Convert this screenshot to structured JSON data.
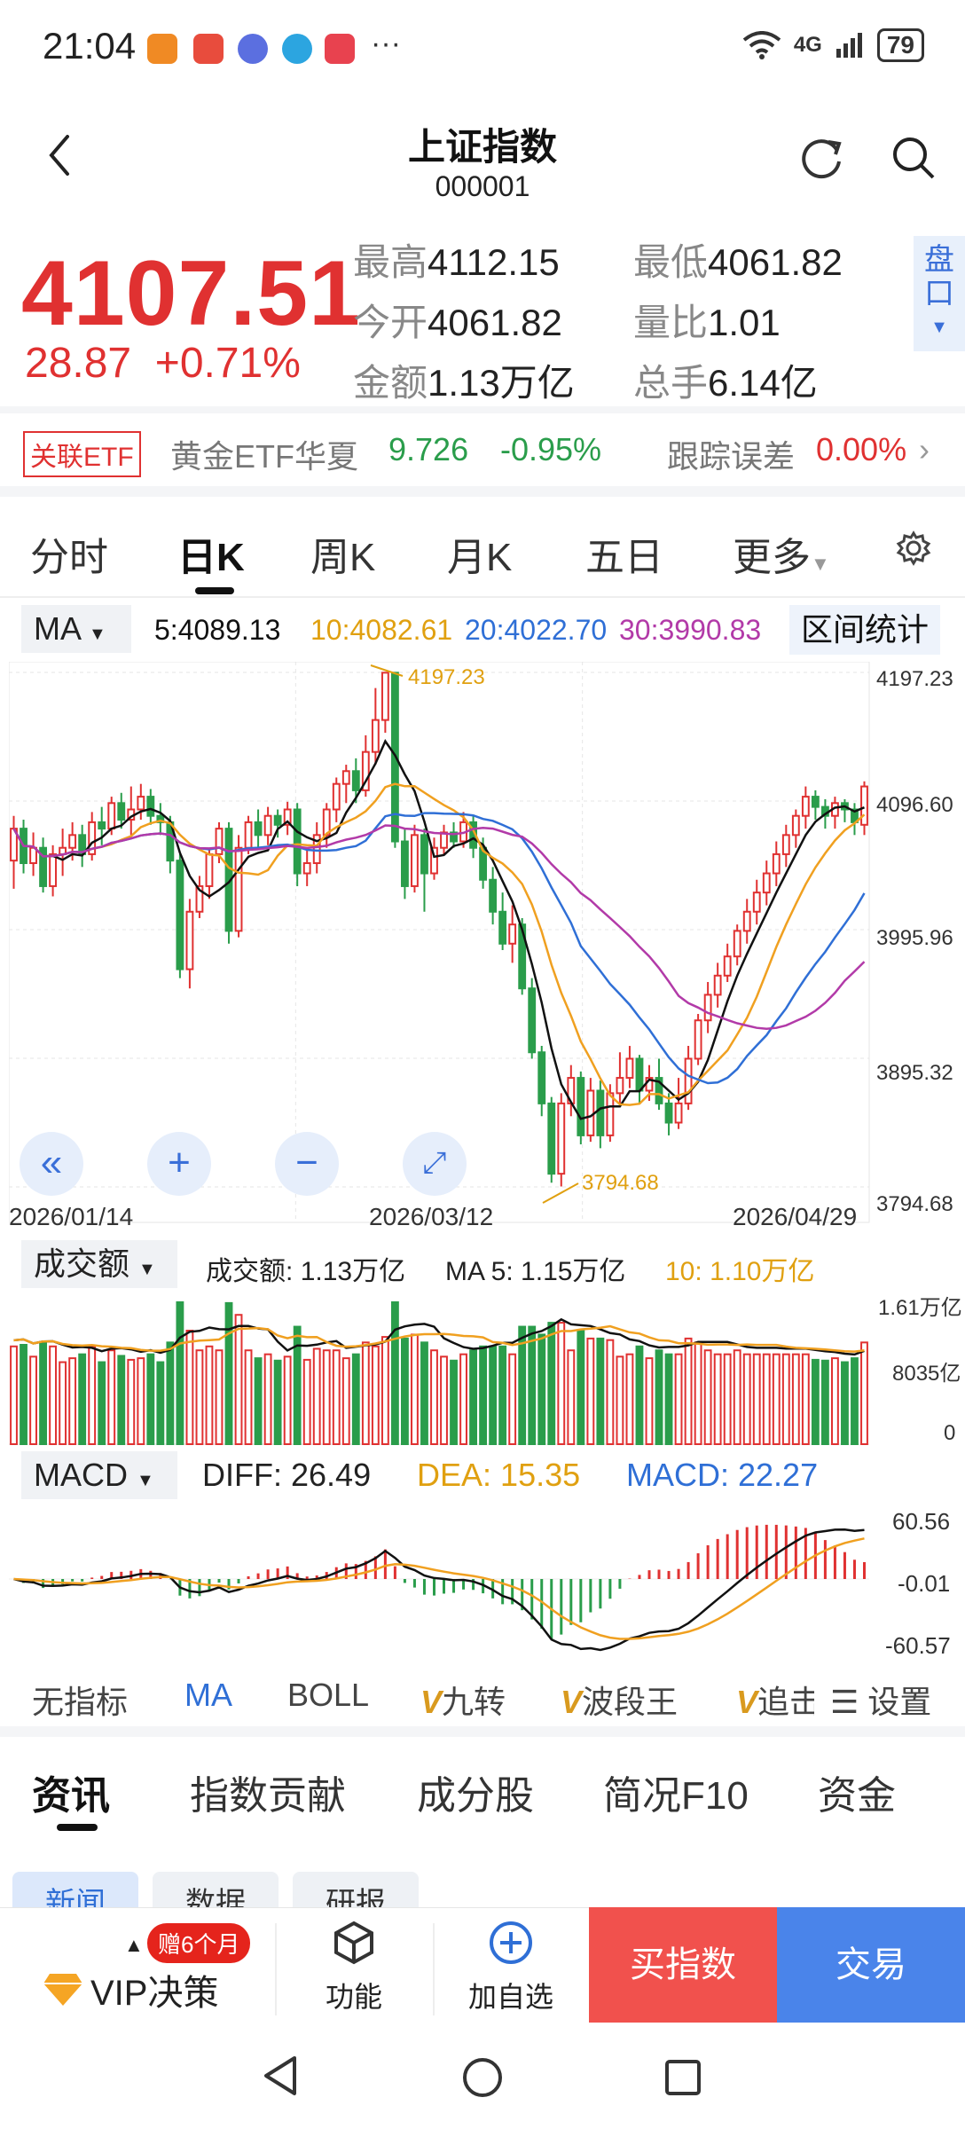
{
  "status": {
    "time": "21:04",
    "dots": "···",
    "network": "4G",
    "battery": "79"
  },
  "header": {
    "title": "上证指数",
    "code": "000001"
  },
  "quote": {
    "price": "4107.51",
    "change": "28.87",
    "change_pct": "+0.71%",
    "high_label": "最高",
    "high": "4112.15",
    "low_label": "最低",
    "low": "4061.82",
    "open_label": "今开",
    "open": "4061.82",
    "vol_ratio_label": "量比",
    "vol_ratio": "1.01",
    "amount_label": "金额",
    "amount": "1.13万亿",
    "turnover_label": "总手",
    "turnover": "6.14亿",
    "pankou": [
      "盘",
      "口"
    ]
  },
  "etf": {
    "tag": "关联ETF",
    "name": "黄金ETF华夏",
    "price": "9.726",
    "pct": "-0.95%",
    "track_label": "跟踪误差",
    "track": "0.00%"
  },
  "period_tabs": [
    "分时",
    "日K",
    "周K",
    "月K",
    "五日",
    "更多"
  ],
  "ma": {
    "select": "MA",
    "ma5": "5:4089.13",
    "ma10": "10:4082.61",
    "ma20": "20:4022.70",
    "ma30": "30:3990.83",
    "range_button": "区间统计"
  },
  "axis": {
    "y_ticks": [
      "4197.23",
      "4096.60",
      "3995.96",
      "3895.32",
      "3794.68"
    ],
    "dates": [
      "2026/01/14",
      "2026/03/12",
      "2026/04/29"
    ],
    "hi_mark": "4197.23",
    "lo_mark": "3794.68"
  },
  "volume": {
    "select": "成交额",
    "value_label": "成交额:",
    "value": "1.13万亿",
    "ma5_label": "MA 5:",
    "ma5": "1.15万亿",
    "ma10_label": "10:",
    "ma10": "1.10万亿",
    "ticks": [
      "1.61万亿",
      "8035亿",
      "0"
    ]
  },
  "macd": {
    "select": "MACD",
    "diff_label": "DIFF:",
    "diff": "26.49",
    "dea_label": "DEA:",
    "dea": "15.35",
    "macd_label": "MACD:",
    "macd": "22.27",
    "ticks": [
      "60.56",
      "-0.01",
      "-60.57"
    ]
  },
  "indicators": [
    "无指标",
    "MA",
    "BOLL",
    "九转",
    "波段王",
    "追击",
    "设置"
  ],
  "bottom_tabs": [
    "资讯",
    "指数贡献",
    "成分股",
    "简况F10",
    "资金"
  ],
  "sub_tabs": [
    "新闻",
    "数据",
    "研报"
  ],
  "actions": {
    "gift": "赠6个月",
    "vip": "VIP决策",
    "func": "功能",
    "add": "加自选",
    "buy": "买指数",
    "trade": "交易"
  },
  "colors": {
    "up": "#e03131",
    "down": "#2a9d4b",
    "ma5": "#111111",
    "ma10": "#f0a020",
    "ma20": "#2f6fd6",
    "ma30": "#b23aa8",
    "accent": "#3a6fd8"
  },
  "chart_data": {
    "type": "candlestick",
    "ylim": [
      3794.68,
      4197.23
    ],
    "candles": [
      [
        4050,
        4075,
        4028,
        4085
      ],
      [
        4075,
        4048,
        4040,
        4082
      ],
      [
        4048,
        4060,
        4038,
        4072
      ],
      [
        4060,
        4030,
        4025,
        4068
      ],
      [
        4030,
        4055,
        4022,
        4062
      ],
      [
        4055,
        4060,
        4038,
        4075
      ],
      [
        4060,
        4070,
        4050,
        4080
      ],
      [
        4070,
        4055,
        4045,
        4078
      ],
      [
        4055,
        4080,
        4050,
        4088
      ],
      [
        4080,
        4075,
        4062,
        4092
      ],
      [
        4075,
        4095,
        4070,
        4100
      ],
      [
        4095,
        4082,
        4075,
        4103
      ],
      [
        4082,
        4090,
        4070,
        4108
      ],
      [
        4090,
        4100,
        4082,
        4110
      ],
      [
        4100,
        4085,
        4078,
        4106
      ],
      [
        4085,
        4080,
        4070,
        4095
      ],
      [
        4080,
        4050,
        4040,
        4085
      ],
      [
        4050,
        3965,
        3958,
        4055
      ],
      [
        3965,
        4010,
        3950,
        4020
      ],
      [
        4010,
        4030,
        4005,
        4038
      ],
      [
        4030,
        4055,
        4020,
        4060
      ],
      [
        4055,
        4075,
        4048,
        4080
      ],
      [
        4075,
        3995,
        3985,
        4080
      ],
      [
        3995,
        4060,
        3990,
        4070
      ],
      [
        4060,
        4080,
        4055,
        4085
      ],
      [
        4080,
        4070,
        4060,
        4090
      ],
      [
        4070,
        4085,
        4062,
        4092
      ],
      [
        4085,
        4078,
        4068,
        4090
      ],
      [
        4078,
        4090,
        4070,
        4096
      ],
      [
        4090,
        4040,
        4030,
        4095
      ],
      [
        4040,
        4048,
        4030,
        4060
      ],
      [
        4048,
        4070,
        4040,
        4080
      ],
      [
        4070,
        4090,
        4060,
        4095
      ],
      [
        4090,
        4110,
        4080,
        4115
      ],
      [
        4110,
        4120,
        4095,
        4125
      ],
      [
        4120,
        4105,
        4095,
        4130
      ],
      [
        4105,
        4135,
        4100,
        4148
      ],
      [
        4135,
        4160,
        4125,
        4185
      ],
      [
        4160,
        4197,
        4150,
        4197
      ],
      [
        4197,
        4065,
        4060,
        4197
      ],
      [
        4065,
        4030,
        4020,
        4075
      ],
      [
        4030,
        4070,
        4025,
        4078
      ],
      [
        4070,
        4040,
        4010,
        4075
      ],
      [
        4040,
        4060,
        4035,
        4068
      ],
      [
        4060,
        4072,
        4055,
        4078
      ],
      [
        4072,
        4065,
        4060,
        4080
      ],
      [
        4065,
        4080,
        4060,
        4088
      ],
      [
        4080,
        4060,
        4052,
        4085
      ],
      [
        4060,
        4035,
        4028,
        4068
      ],
      [
        4035,
        4010,
        4000,
        4045
      ],
      [
        4010,
        3985,
        3980,
        4025
      ],
      [
        3985,
        4000,
        3970,
        4015
      ],
      [
        4000,
        3950,
        3945,
        4005
      ],
      [
        3950,
        3900,
        3895,
        3958
      ],
      [
        3900,
        3860,
        3850,
        3905
      ],
      [
        3860,
        3805,
        3798,
        3865
      ],
      [
        3805,
        3860,
        3795,
        3868
      ],
      [
        3860,
        3880,
        3850,
        3890
      ],
      [
        3880,
        3835,
        3828,
        3885
      ],
      [
        3835,
        3870,
        3830,
        3880
      ],
      [
        3870,
        3835,
        3825,
        3878
      ],
      [
        3835,
        3868,
        3830,
        3875
      ],
      [
        3868,
        3880,
        3860,
        3900
      ],
      [
        3880,
        3895,
        3872,
        3905
      ],
      [
        3895,
        3870,
        3860,
        3898
      ],
      [
        3870,
        3880,
        3862,
        3890
      ],
      [
        3880,
        3860,
        3855,
        3895
      ],
      [
        3860,
        3845,
        3835,
        3868
      ],
      [
        3845,
        3860,
        3840,
        3880
      ],
      [
        3860,
        3895,
        3855,
        3905
      ],
      [
        3895,
        3925,
        3890,
        3930
      ],
      [
        3925,
        3945,
        3915,
        3955
      ],
      [
        3945,
        3960,
        3935,
        3970
      ],
      [
        3960,
        3975,
        3955,
        3985
      ],
      [
        3975,
        3995,
        3968,
        4000
      ],
      [
        3995,
        4010,
        3985,
        4020
      ],
      [
        4010,
        4025,
        4000,
        4035
      ],
      [
        4025,
        4040,
        4015,
        4050
      ],
      [
        4040,
        4055,
        4030,
        4065
      ],
      [
        4055,
        4070,
        4045,
        4078
      ],
      [
        4070,
        4085,
        4060,
        4090
      ],
      [
        4085,
        4100,
        4075,
        4108
      ],
      [
        4100,
        4092,
        4082,
        4105
      ],
      [
        4092,
        4085,
        4075,
        4098
      ],
      [
        4085,
        4095,
        4075,
        4100
      ],
      [
        4095,
        4090,
        4080,
        4098
      ],
      [
        4090,
        4080,
        4070,
        4095
      ],
      [
        4078,
        4108,
        4070,
        4112
      ]
    ]
  }
}
